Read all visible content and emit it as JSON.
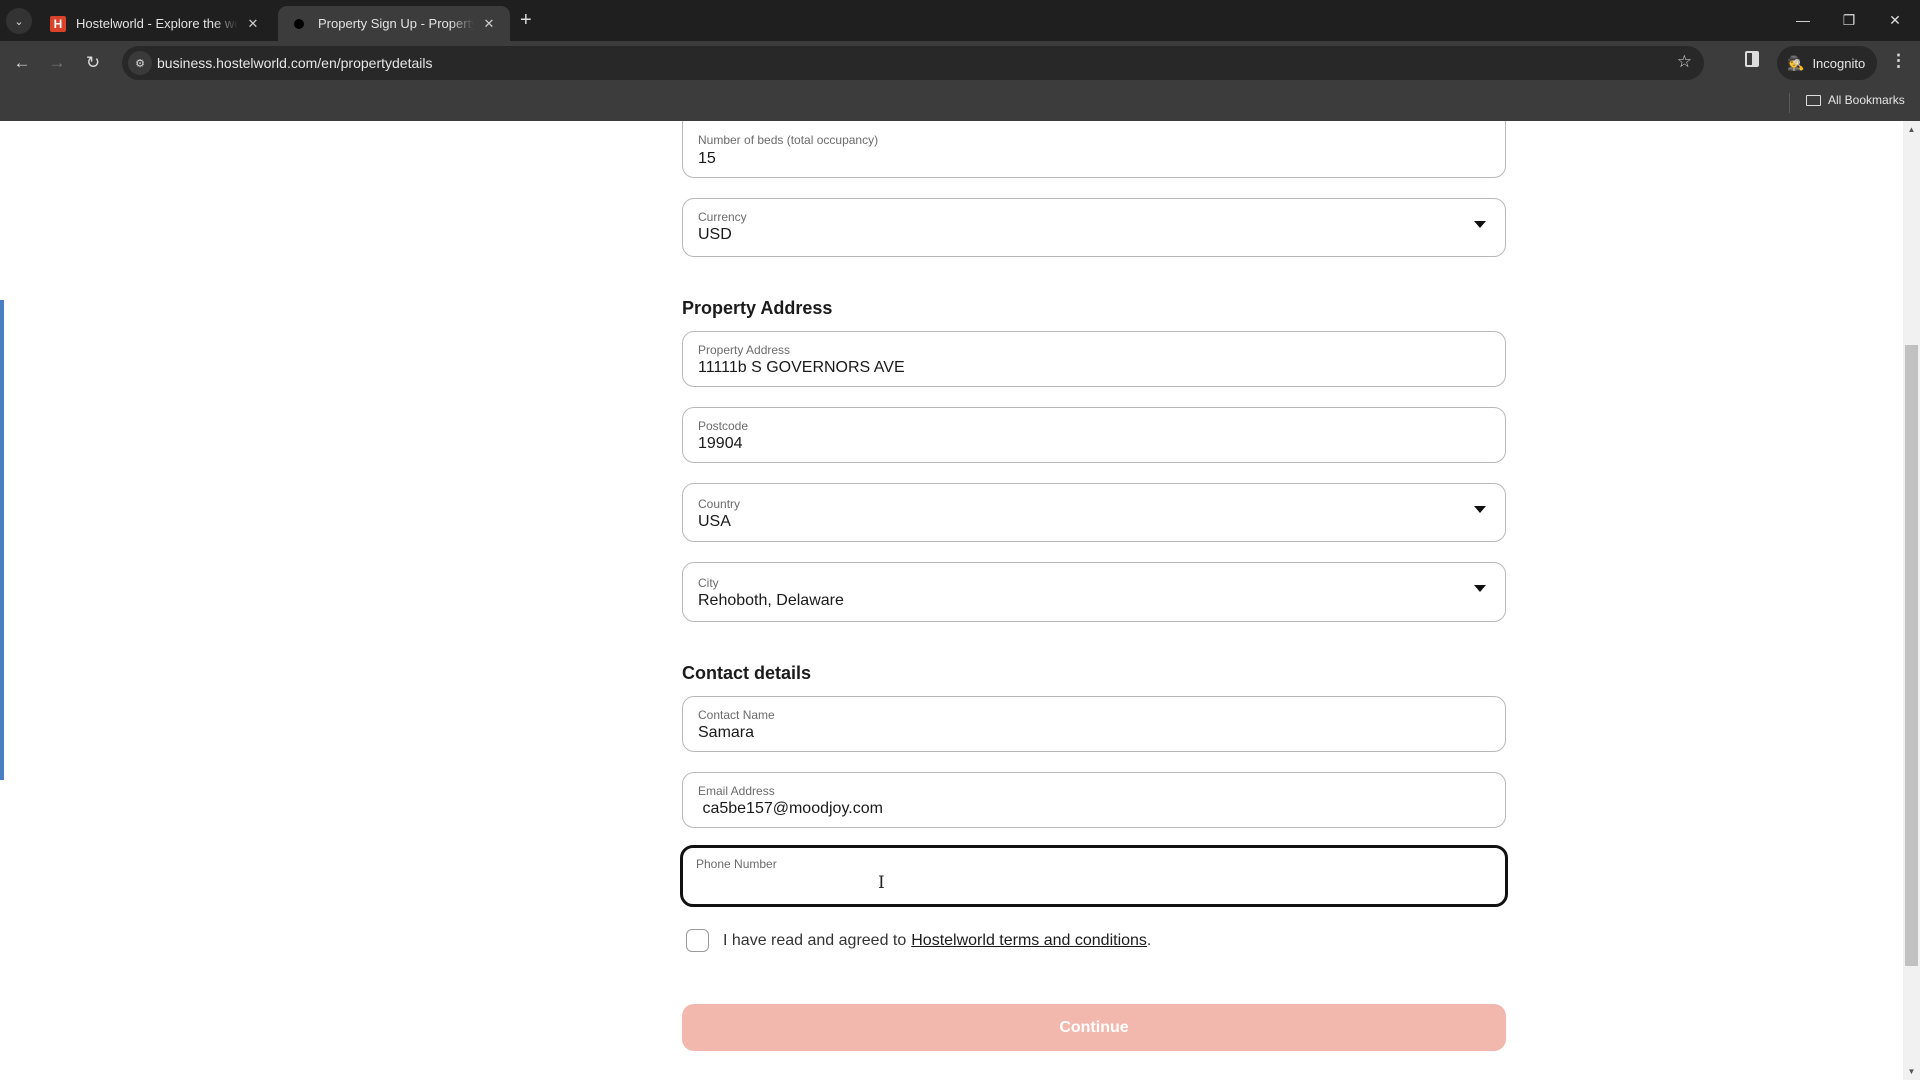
{
  "browser": {
    "tabs": [
      {
        "title": "Hostelworld - Explore the world",
        "favicon": "H",
        "active": false
      },
      {
        "title": "Property Sign Up - Property and",
        "favicon": "dot",
        "active": true
      }
    ],
    "url": "business.hostelworld.com/en/propertydetails",
    "incognito_label": "Incognito",
    "all_bookmarks_label": "All Bookmarks",
    "icons": {
      "tab_search": "⌄",
      "close": "✕",
      "new_tab": "+",
      "minimize": "—",
      "restore": "❐",
      "window_close": "✕",
      "back": "←",
      "forward": "→",
      "reload": "↻",
      "site_info": "⚙",
      "star": "☆",
      "incognito": "🕵",
      "menu": "⋮"
    }
  },
  "form": {
    "fields": {
      "beds": {
        "label": "Number of beds (total occupancy)",
        "value": "15"
      },
      "currency": {
        "label": "Currency",
        "value": "USD"
      },
      "address": {
        "label": "Property Address",
        "value": "11111b S GOVERNORS AVE"
      },
      "postcode": {
        "label": "Postcode",
        "value": "19904"
      },
      "country": {
        "label": "Country",
        "value": "USA"
      },
      "city": {
        "label": "City",
        "value": "Rehoboth, Delaware"
      },
      "contact_name": {
        "label": "Contact Name",
        "value": "Samara"
      },
      "email": {
        "label": "Email Address",
        "value": " ca5be157@moodjoy.com"
      },
      "phone": {
        "label": "Phone Number",
        "value": ""
      }
    },
    "sections": {
      "property_address": "Property Address",
      "contact_details": "Contact details"
    },
    "terms": {
      "prefix": "I have read and agreed to",
      "link": "Hostelworld terms and conditions",
      "suffix": ".",
      "checked": false
    },
    "continue_label": "Continue",
    "colors": {
      "continue_disabled": "#f3b8ad",
      "accent_bar": "#4a7ec2"
    }
  }
}
